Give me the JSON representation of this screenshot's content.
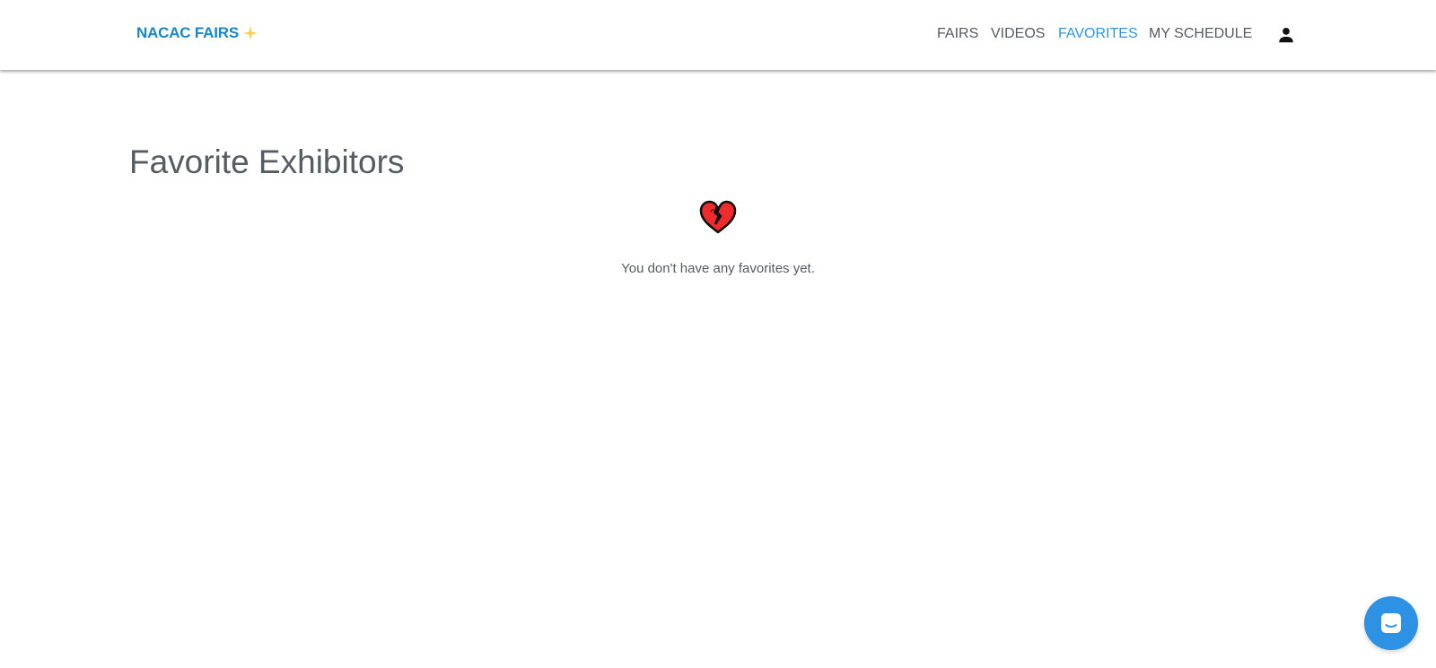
{
  "brand": {
    "logo_text": "NACAC FAIRS",
    "logo_icon": "star-icon",
    "accent_color": "#1787c9",
    "star_color": "#f7d23e"
  },
  "nav": {
    "items": [
      {
        "label": "FAIRS",
        "active": false
      },
      {
        "label": "VIDEOS",
        "active": false
      },
      {
        "label": "FAVORITES",
        "active": true
      },
      {
        "label": "MY SCHEDULE",
        "active": false
      }
    ],
    "active_color": "#2b96e3",
    "account_icon": "person-icon"
  },
  "main": {
    "title": "Favorite Exhibitors",
    "empty_icon": "broken-heart-icon",
    "empty_message": "You don't have any favorites yet."
  },
  "chat": {
    "icon": "chat-icon",
    "color": "#2e92e4"
  }
}
